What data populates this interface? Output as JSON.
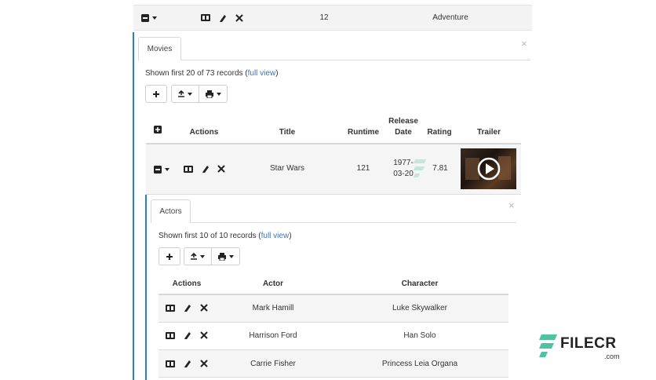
{
  "genre_row": {
    "count": "12",
    "genre": "Adventure"
  },
  "movies_panel": {
    "tab_label": "Movies",
    "records_text": "Shown first 20 of 73 records (",
    "full_view_link": "full view",
    "records_suffix": ")",
    "headers": {
      "actions": "Actions",
      "title": "Title",
      "runtime": "Runtime",
      "release_line1": "Release",
      "release_line2": "Date",
      "rating": "Rating",
      "trailer": "Trailer"
    },
    "row": {
      "title": "Star Wars",
      "runtime": "121",
      "release_line1": "1977-",
      "release_line2": "03-20",
      "rating": "7.81"
    }
  },
  "actors_panel": {
    "tab_label": "Actors",
    "records_text": "Shown first 10 of 10 records (",
    "full_view_link": "full view",
    "records_suffix": ")",
    "headers": {
      "actions": "Actions",
      "actor": "Actor",
      "character": "Character"
    },
    "rows": [
      {
        "actor": "Mark Hamill",
        "character": "Luke Skywalker"
      },
      {
        "actor": "Harrison Ford",
        "character": "Han Solo"
      },
      {
        "actor": "Carrie Fisher",
        "character": "Princess Leia Organa"
      }
    ]
  },
  "watermark": {
    "brand": "FILECR",
    "domain": ".com"
  },
  "colors": {
    "accent_blue": "#2d7bd1",
    "link_blue": "#3a74b5",
    "watermark_green": "#4fc3a1"
  }
}
